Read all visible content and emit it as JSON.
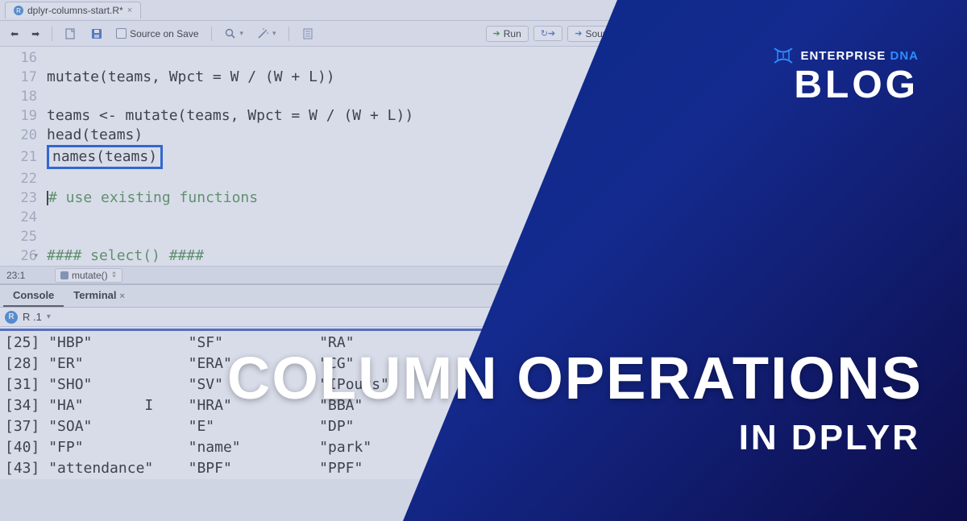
{
  "tab": {
    "filename": "dplyr-columns-start.R*"
  },
  "toolbar": {
    "source_on_save": "Source on Save",
    "run": "Run",
    "source": "Source"
  },
  "editor": {
    "lines": [
      {
        "num": "16",
        "text": ""
      },
      {
        "num": "17",
        "text": "mutate(teams, Wpct = W / (W + L))"
      },
      {
        "num": "18",
        "text": ""
      },
      {
        "num": "19",
        "text": "teams <- mutate(teams, Wpct = W / (W + L))"
      },
      {
        "num": "20",
        "text": "head(teams)"
      },
      {
        "num": "21",
        "text": "names(teams)",
        "highlighted": true
      },
      {
        "num": "22",
        "text": ""
      },
      {
        "num": "23",
        "text": "# use existing functions",
        "comment": true,
        "cursor": true
      },
      {
        "num": "24",
        "text": ""
      },
      {
        "num": "25",
        "text": ""
      },
      {
        "num": "26",
        "text": "#### select() ####",
        "comment": true
      }
    ]
  },
  "status": {
    "position": "23:1",
    "fn": "mutate()"
  },
  "console": {
    "tab_console": "Console",
    "tab_terminal": "Terminal",
    "r_version": "R    .1",
    "rows": [
      {
        "idx": "[25]",
        "c1": "\"HBP\"",
        "c2": "\"SF\"",
        "c3": "\"RA\""
      },
      {
        "idx": "[28]",
        "c1": "\"ER\"",
        "c2": "\"ERA\"",
        "c3": "\"CG\""
      },
      {
        "idx": "[31]",
        "c1": "\"SHO\"",
        "c2": "\"SV\"",
        "c3": "\"IPouts\""
      },
      {
        "idx": "[34]",
        "c1": "\"HA\"",
        "c2": "\"HRA\"",
        "c3": "\"BBA\"",
        "cursor": true
      },
      {
        "idx": "[37]",
        "c1": "\"SOA\"",
        "c2": "\"E\"",
        "c3": "\"DP\""
      },
      {
        "idx": "[40]",
        "c1": "\"FP\"",
        "c2": "\"name\"",
        "c3": "\"park\""
      },
      {
        "idx": "[43]",
        "c1": "\"attendance\"",
        "c2": "\"BPF\"",
        "c3": "\"PPF\""
      }
    ]
  },
  "branding": {
    "company": "ENTERPRISE",
    "dna": "DNA",
    "blog": "BLOG"
  },
  "headline": {
    "main": "COLUMN OPERATIONS",
    "sub": "IN DPLYR"
  }
}
